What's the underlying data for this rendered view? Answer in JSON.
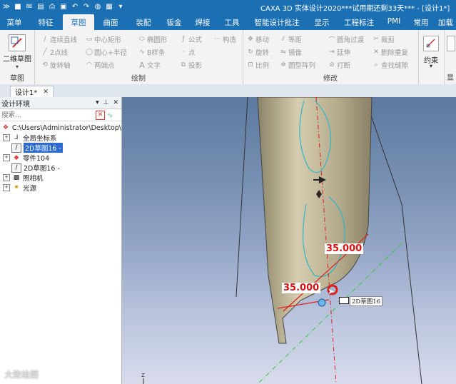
{
  "app": {
    "title": "CAXA 3D 实体设计2020***试用期还剩33天*** - [设计1*]"
  },
  "colors": {
    "accent": "#1b6fb3",
    "dimension": "#d11111",
    "selection": "#2d6bd0"
  },
  "quick_access_icons": [
    "app-menu-icon",
    "new-icon",
    "mail-icon",
    "open-icon",
    "print-icon",
    "save-icon",
    "undo-icon",
    "redo-icon",
    "globe-icon",
    "option-icon",
    "dropdown-icon"
  ],
  "menu": {
    "tabs": [
      "菜单",
      "特征",
      "草图",
      "曲面",
      "装配",
      "钣金",
      "焊接",
      "工具",
      "智能设计批注",
      "显示",
      "工程标注",
      "PMI",
      "常用",
      "加载"
    ],
    "active": "草图"
  },
  "ribbon": {
    "sketch_group": {
      "big_button": "二维草图",
      "label": "草图"
    },
    "draw_group": {
      "label": "绘制",
      "col1": [
        "连续直线",
        "2点线",
        "旋转轴"
      ],
      "col2": [
        "中心矩形",
        "圆心+半径",
        "两端点"
      ],
      "col3": [
        "椭圆形",
        "B样条",
        "文字"
      ],
      "col4": [
        "公式",
        "点",
        "投影"
      ],
      "col5": [
        "构造"
      ]
    },
    "modify_group": {
      "label": "修改",
      "col1": [
        "移动",
        "旋转",
        "比例"
      ],
      "col2": [
        "等距",
        "镜像",
        "圆型阵列"
      ],
      "col3": [
        "圆角过渡",
        "延伸",
        "打断"
      ],
      "col4": [
        "裁剪",
        "删除重复",
        "查找缝隙"
      ]
    },
    "constraint_group": {
      "label": "约束"
    },
    "display_group": {
      "label": "显"
    }
  },
  "doc_tab": {
    "label": "设计1*"
  },
  "design_panel": {
    "title": "设计环境",
    "search_placeholder": "搜索...",
    "tree": [
      {
        "label": "C:\\Users\\Administrator\\Desktop\\",
        "icon": "design-env-icon",
        "indent": 0,
        "expander": "",
        "selected": false
      },
      {
        "label": "全局坐标系",
        "icon": "axes-icon",
        "indent": 1,
        "expander": "+",
        "selected": false
      },
      {
        "label": "2D草图16 -",
        "icon": "sketch-icon",
        "indent": 1,
        "expander": "",
        "selected": true
      },
      {
        "label": "零件104",
        "icon": "part-icon",
        "indent": 1,
        "expander": "+",
        "selected": false
      },
      {
        "label": "2D草图16 -",
        "icon": "sketch-icon",
        "indent": 1,
        "expander": "",
        "selected": false
      },
      {
        "label": "照相机",
        "icon": "camera-icon",
        "indent": 1,
        "expander": "+",
        "selected": false
      },
      {
        "label": "光源",
        "icon": "light-icon",
        "indent": 1,
        "expander": "+",
        "selected": false
      }
    ]
  },
  "viewport": {
    "dimension_top": "35.000",
    "dimension_bottom": "35.000",
    "hover_tooltip": "2D草图16",
    "axis_label": "Z"
  },
  "watermark": "大致绘图"
}
